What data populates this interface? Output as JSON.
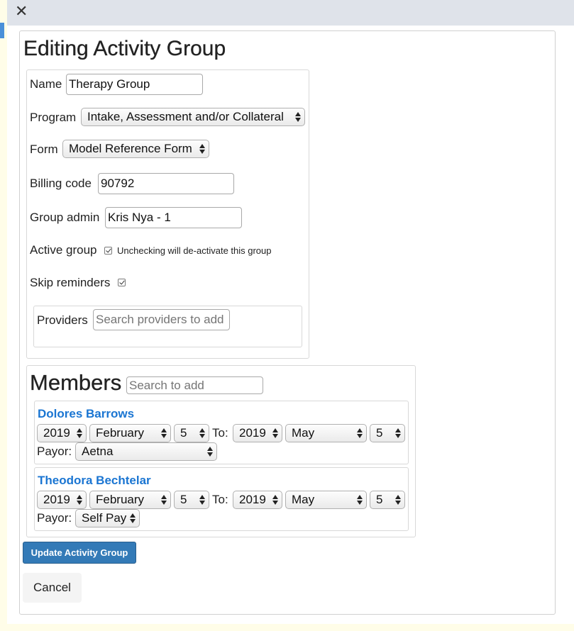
{
  "modal": {
    "close_glyph": "✕"
  },
  "page": {
    "title": "Editing Activity Group"
  },
  "form": {
    "name_label": "Name",
    "name_value": "Therapy Group",
    "program_label": "Program",
    "program_value": "Intake, Assessment and/or Collateral",
    "form_label": "Form",
    "form_value": "Model Reference Form",
    "billing_label": "Billing code",
    "billing_value": "90792",
    "admin_label": "Group admin",
    "admin_value": "Kris Nya - 1",
    "active_label": "Active group",
    "active_checked": true,
    "active_note": "Unchecking will de-activate this group",
    "skip_label": "Skip reminders",
    "skip_checked": true,
    "providers_label": "Providers",
    "providers_placeholder": "Search providers to add"
  },
  "members": {
    "title": "Members",
    "search_placeholder": "Search to add",
    "to_label": "To:",
    "payor_label": "Payor:",
    "items": [
      {
        "name": "Dolores Barrows",
        "from_year": "2019",
        "from_month": "February",
        "from_day": "5",
        "to_year": "2019",
        "to_month": "May",
        "to_day": "5",
        "payor": "Aetna"
      },
      {
        "name": "Theodora Bechtelar",
        "from_year": "2019",
        "from_month": "February",
        "from_day": "5",
        "to_year": "2019",
        "to_month": "May",
        "to_day": "5",
        "payor": "Self Pay"
      }
    ]
  },
  "actions": {
    "update_label": "Update Activity Group",
    "cancel_label": "Cancel"
  },
  "colors": {
    "header_bg": "#dfe3ea",
    "link": "#1a75d2",
    "primary_button": "#337ab7"
  }
}
